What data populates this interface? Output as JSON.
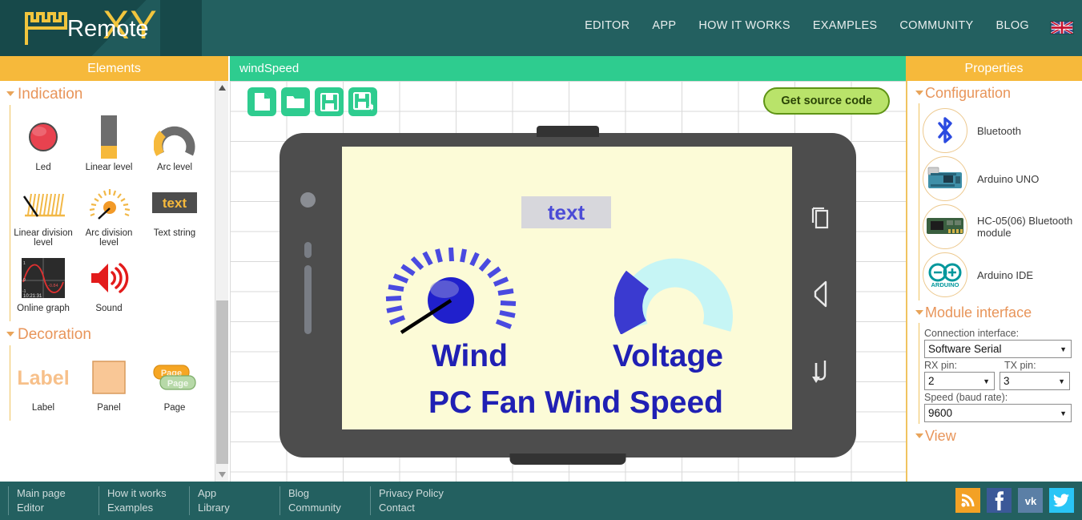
{
  "brand": {
    "name": "Remote",
    "suffix": "XY",
    "flag": "uk-flag-icon"
  },
  "topnav": {
    "links": [
      {
        "label": "EDITOR"
      },
      {
        "label": "APP"
      },
      {
        "label": "HOW IT WORKS"
      },
      {
        "label": "EXAMPLES"
      },
      {
        "label": "COMMUNITY"
      },
      {
        "label": "BLOG"
      }
    ]
  },
  "elements_panel": {
    "title": "Elements",
    "sections": [
      {
        "title": "Indication",
        "items": [
          {
            "label": "Led",
            "icon": "led-icon"
          },
          {
            "label": "Linear level",
            "icon": "linear-level-icon"
          },
          {
            "label": "Arc level",
            "icon": "arc-level-icon"
          },
          {
            "label": "Linear division level",
            "icon": "linear-division-level-icon"
          },
          {
            "label": "Arc division level",
            "icon": "arc-division-level-icon"
          },
          {
            "label": "Text string",
            "icon": "text-string-icon"
          },
          {
            "label": "Online graph",
            "icon": "online-graph-icon"
          },
          {
            "label": "Sound",
            "icon": "sound-icon"
          }
        ]
      },
      {
        "title": "Decoration",
        "items": [
          {
            "label": "Label",
            "icon": "label-icon"
          },
          {
            "label": "Panel",
            "icon": "panel-icon"
          },
          {
            "label": "Page",
            "icon": "page-icon"
          }
        ]
      }
    ]
  },
  "canvas": {
    "project_title": "windSpeed",
    "toolbar": [
      {
        "name": "new-file-button",
        "icon": "file-icon"
      },
      {
        "name": "open-file-button",
        "icon": "folder-icon"
      },
      {
        "name": "save-button",
        "icon": "floppy-icon"
      },
      {
        "name": "save-as-button",
        "icon": "floppy-star-icon"
      }
    ],
    "get_source_label": "Get source code",
    "phone": {
      "nav_buttons": [
        {
          "name": "recent-apps-button",
          "icon": "recent-apps-icon"
        },
        {
          "name": "back-button",
          "icon": "back-icon"
        },
        {
          "name": "home-button",
          "icon": "home-return-icon"
        }
      ],
      "screen": {
        "background": "#fcfbd7",
        "widgets": [
          {
            "type": "text-string",
            "value": "text",
            "color": "#4b4bd6",
            "background": "#d7d7dc"
          },
          {
            "type": "arc-division-level",
            "name": "wind-gauge",
            "color": "#3333cc",
            "value": 8
          },
          {
            "type": "arc-level",
            "name": "voltage-gauge",
            "color": "#3a3ad0",
            "track": "#c6f5f5",
            "value": 30
          },
          {
            "type": "label",
            "value": "Wind",
            "color": "#2020b4"
          },
          {
            "type": "label",
            "value": "Voltage",
            "color": "#2020b4"
          },
          {
            "type": "label",
            "value": "PC Fan Wind Speed",
            "color": "#2020b4"
          }
        ]
      }
    }
  },
  "properties": {
    "title": "Properties",
    "sections": {
      "configuration": {
        "title": "Configuration",
        "items": [
          {
            "label": "Bluetooth",
            "icon": "bluetooth-icon"
          },
          {
            "label": "Arduino UNO",
            "icon": "arduino-uno-icon"
          },
          {
            "label": "HC-05(06) Bluetooth module",
            "icon": "hc05-module-icon"
          },
          {
            "label": "Arduino IDE",
            "icon": "arduino-ide-icon"
          }
        ]
      },
      "module_interface": {
        "title": "Module interface",
        "fields": [
          {
            "label": "Connection interface:",
            "value": "Software Serial"
          },
          {
            "label": "RX pin:",
            "value": "2"
          },
          {
            "label": "TX pin:",
            "value": "3"
          },
          {
            "label": "Speed (baud rate):",
            "value": "9600"
          }
        ]
      },
      "view": {
        "title": "View"
      }
    }
  },
  "footer": {
    "columns": [
      {
        "links": [
          "Main page",
          "Editor"
        ]
      },
      {
        "links": [
          "How it works",
          "Examples"
        ]
      },
      {
        "links": [
          "App",
          "Library"
        ]
      },
      {
        "links": [
          "Blog",
          "Community"
        ]
      },
      {
        "links": [
          "Privacy Policy",
          "Contact"
        ]
      }
    ],
    "social": [
      {
        "name": "rss-icon",
        "color": "#f3a125"
      },
      {
        "name": "facebook-icon",
        "color": "#3b5998"
      },
      {
        "name": "vk-icon",
        "color": "#5b7fa6"
      },
      {
        "name": "twitter-icon",
        "color": "#29c5f6"
      }
    ]
  },
  "colors": {
    "brand_dark": "#17494a",
    "nav_teal": "#236060",
    "accent_orange": "#f6b93b",
    "canvas_green": "#2ecc8f",
    "section_orange": "#e8955a"
  }
}
